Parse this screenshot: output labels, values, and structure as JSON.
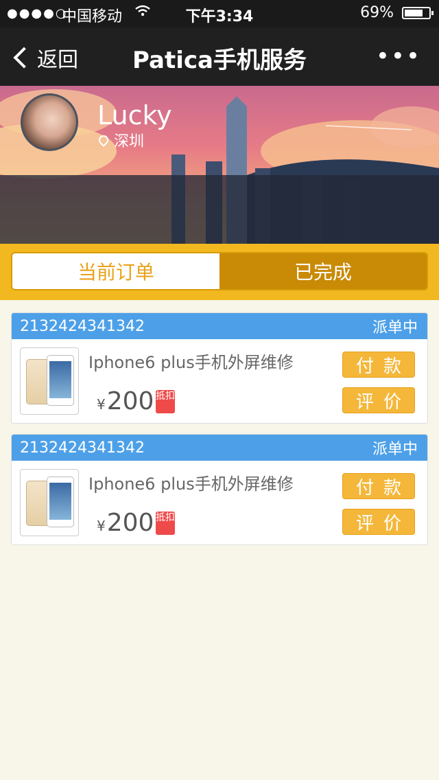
{
  "status_bar": {
    "signal": "●●●●○",
    "carrier": "中国移动",
    "time": "下午3:34",
    "battery": "69%",
    "battery_level": 0.69
  },
  "nav": {
    "back_label": "返回",
    "title": "Patica手机服务",
    "more_label": "•••"
  },
  "profile": {
    "name": "Lucky",
    "city": "深圳"
  },
  "tabs": [
    {
      "label": "当前订单",
      "active": true
    },
    {
      "label": "已完成",
      "active": false
    }
  ],
  "orders": [
    {
      "order_no": "2132424341342",
      "status": "派单中",
      "product": "Iphone6 plus手机外屏维修",
      "currency": "¥",
      "price": "200",
      "discount_tag": "抵扣",
      "pay_label": "付款",
      "review_label": "评价"
    },
    {
      "order_no": "2132424341342",
      "status": "派单中",
      "product": "Iphone6 plus手机外屏维修",
      "currency": "¥",
      "price": "200",
      "discount_tag": "抵扣",
      "pay_label": "付款",
      "review_label": "评价"
    }
  ],
  "colors": {
    "accent": "#f2b820",
    "header_blue": "#4da0e8",
    "tag_red": "#ef4a4a",
    "button": "#f4b73a"
  }
}
